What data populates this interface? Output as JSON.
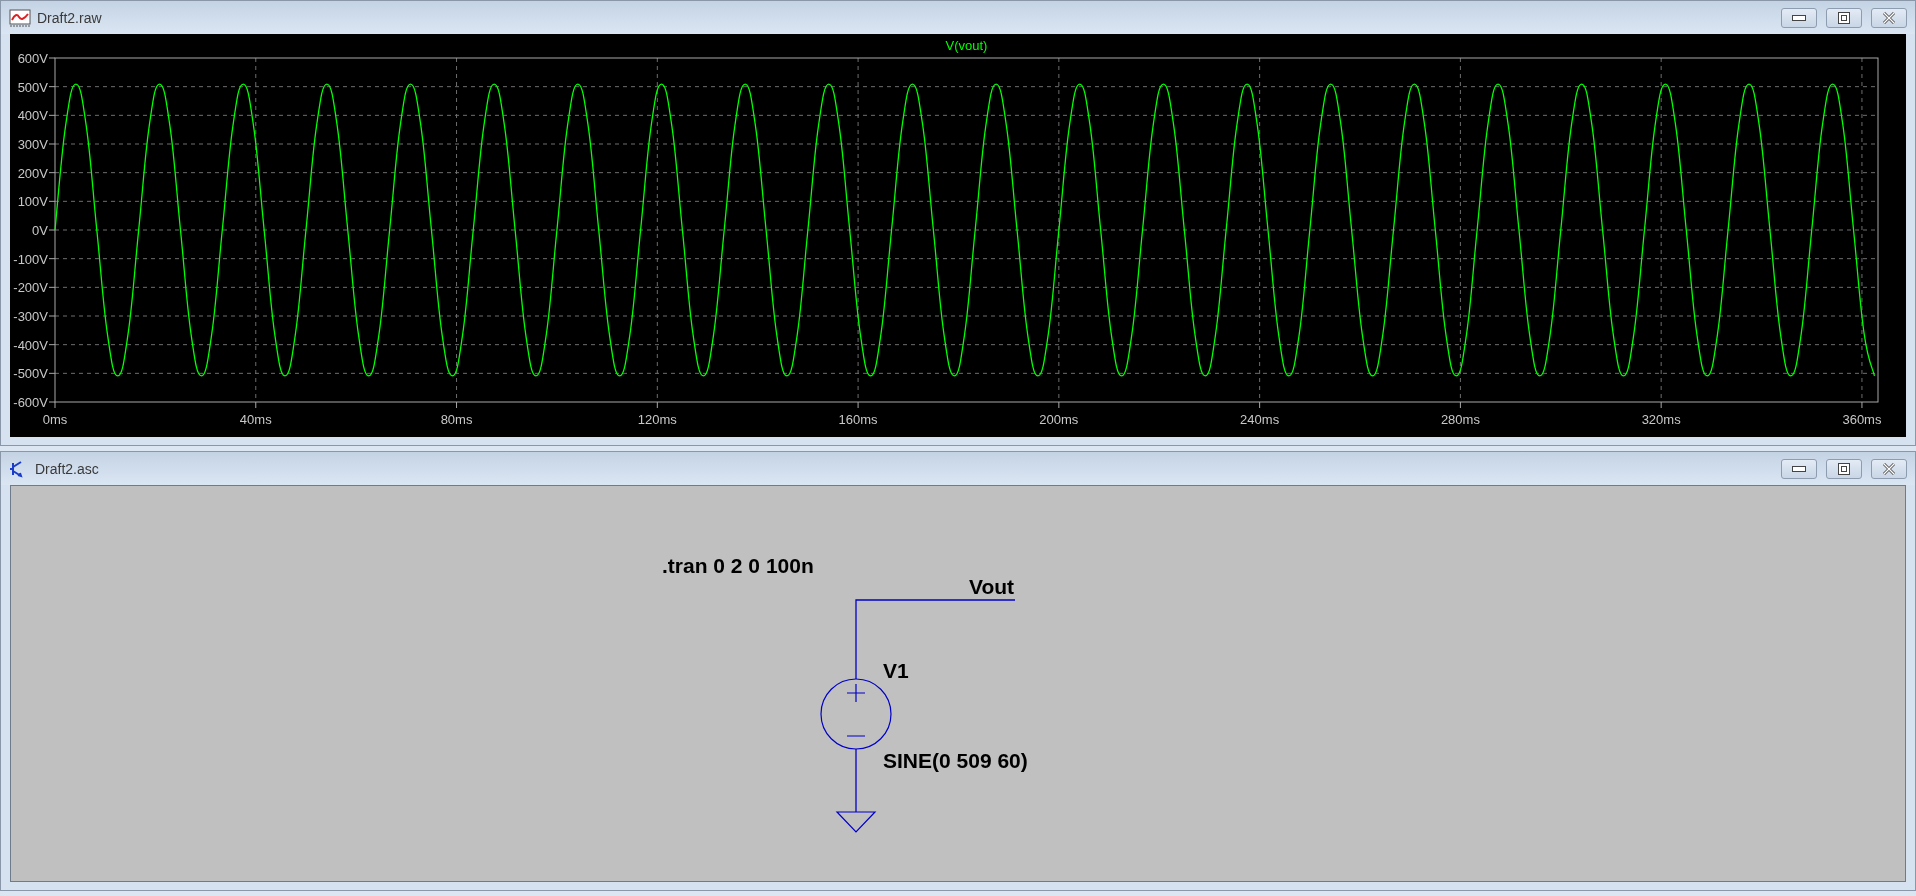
{
  "waveform_window": {
    "title": "Draft2.raw",
    "chart_data": {
      "type": "line",
      "grid": true,
      "xlim": [
        0,
        363.2
      ],
      "ylim": [
        -600,
        600
      ],
      "xticks": [
        {
          "value": 0,
          "label": "0ms"
        },
        {
          "value": 40,
          "label": "40ms"
        },
        {
          "value": 80,
          "label": "80ms"
        },
        {
          "value": 120,
          "label": "120ms"
        },
        {
          "value": 160,
          "label": "160ms"
        },
        {
          "value": 200,
          "label": "200ms"
        },
        {
          "value": 240,
          "label": "240ms"
        },
        {
          "value": 280,
          "label": "280ms"
        },
        {
          "value": 320,
          "label": "320ms"
        },
        {
          "value": 360,
          "label": "360ms"
        }
      ],
      "yticks": [
        {
          "value": 600,
          "label": "600V"
        },
        {
          "value": 500,
          "label": "500V"
        },
        {
          "value": 400,
          "label": "400V"
        },
        {
          "value": 300,
          "label": "300V"
        },
        {
          "value": 200,
          "label": "200V"
        },
        {
          "value": 100,
          "label": "100V"
        },
        {
          "value": 0,
          "label": "0V"
        },
        {
          "value": -100,
          "label": "-100V"
        },
        {
          "value": -200,
          "label": "-200V"
        },
        {
          "value": -300,
          "label": "-300V"
        },
        {
          "value": -400,
          "label": "-400V"
        },
        {
          "value": -500,
          "label": "-500V"
        },
        {
          "value": -600,
          "label": "-600V"
        }
      ],
      "x": [
        0,
        2.08,
        4.17,
        6.25,
        8.33,
        10.42,
        12.5,
        14.58,
        16.67,
        18.75,
        20.83,
        22.92,
        25,
        27.08,
        29.17,
        31.25,
        33.33,
        35.42,
        37.5,
        39.58,
        41.67,
        43.75,
        45.83,
        47.92,
        50,
        52.08,
        54.17,
        56.25,
        58.33,
        60.42,
        62.5,
        64.58,
        66.67,
        68.75,
        70.83,
        72.92,
        75,
        77.08,
        79.17,
        81.25,
        83.33,
        85.42,
        87.5,
        89.58,
        91.67,
        93.75,
        95.83,
        97.92,
        100,
        102.08,
        104.17,
        106.25,
        108.33,
        110.42,
        112.5,
        114.58,
        116.67,
        118.75,
        120.83,
        122.92,
        125,
        127.08,
        129.17,
        131.25,
        133.33,
        135.42,
        137.5,
        139.58,
        141.67,
        143.75,
        145.83,
        147.92,
        150,
        152.08,
        154.17,
        156.25,
        158.33,
        160.42,
        162.5,
        164.58,
        166.67,
        168.75,
        170.83,
        172.92,
        175,
        177.08,
        179.17,
        181.25,
        183.33,
        185.42,
        187.5,
        189.58,
        191.67,
        193.75,
        195.83,
        197.92,
        200,
        202.08,
        204.17,
        206.25,
        208.33,
        210.42,
        212.5,
        214.58,
        216.67,
        218.75,
        220.83,
        222.92,
        225,
        227.08,
        229.17,
        231.25,
        233.33,
        235.42,
        237.5,
        239.58,
        241.67,
        243.75,
        245.83,
        247.92,
        250,
        252.08,
        254.17,
        256.25,
        258.33,
        260.42,
        262.5,
        264.58,
        266.67,
        268.75,
        270.83,
        272.92,
        275,
        277.08,
        279.17,
        281.25,
        283.33,
        285.42,
        287.5,
        289.58,
        291.67,
        293.75,
        295.83,
        297.92,
        300,
        302.08,
        304.17,
        306.25,
        308.33,
        310.42,
        312.5,
        314.58,
        316.67,
        318.75,
        320.83,
        322.92,
        325,
        327.08,
        329.17,
        331.25,
        333.33,
        335.42,
        337.5,
        339.58,
        341.67,
        343.75,
        345.83,
        347.92,
        350,
        352.08,
        354.17,
        356.25,
        358.33,
        360.42,
        362.5
      ],
      "series": [
        {
          "name": "V(vout)",
          "color": "#00ff00",
          "values": [
            0,
            360,
            509,
            360,
            0,
            -360,
            -509,
            -360,
            0,
            360,
            509,
            360,
            0,
            -360,
            -509,
            -360,
            0,
            360,
            509,
            360,
            0,
            -360,
            -509,
            -360,
            0,
            360,
            509,
            360,
            0,
            -360,
            -509,
            -360,
            0,
            360,
            509,
            360,
            0,
            -360,
            -509,
            -360,
            0,
            360,
            509,
            360,
            0,
            -360,
            -509,
            -360,
            0,
            360,
            509,
            360,
            0,
            -360,
            -509,
            -360,
            0,
            360,
            509,
            360,
            0,
            -360,
            -509,
            -360,
            0,
            360,
            509,
            360,
            0,
            -360,
            -509,
            -360,
            0,
            360,
            509,
            360,
            0,
            -360,
            -509,
            -360,
            0,
            360,
            509,
            360,
            0,
            -360,
            -509,
            -360,
            0,
            360,
            509,
            360,
            0,
            -360,
            -509,
            -360,
            0,
            360,
            509,
            360,
            0,
            -360,
            -509,
            -360,
            0,
            360,
            509,
            360,
            0,
            -360,
            -509,
            -360,
            0,
            360,
            509,
            360,
            0,
            -360,
            -509,
            -360,
            0,
            360,
            509,
            360,
            0,
            -360,
            -509,
            -360,
            0,
            360,
            509,
            360,
            0,
            -360,
            -509,
            -360,
            0,
            360,
            509,
            360,
            0,
            -360,
            -509,
            -360,
            0,
            360,
            509,
            360,
            0,
            -360,
            -509,
            -360,
            0,
            360,
            509,
            360,
            0,
            -360,
            -509,
            -360,
            0,
            360,
            509,
            360,
            0,
            -360,
            -509,
            -360,
            0,
            360,
            509,
            360,
            0,
            -360,
            -509
          ]
        }
      ]
    }
  },
  "schematic_window": {
    "title": "Draft2.asc",
    "directive": ".tran 0 2 0 100n",
    "net_label": "Vout",
    "component": {
      "name": "V1",
      "value": "SINE(0 509 60)"
    }
  }
}
